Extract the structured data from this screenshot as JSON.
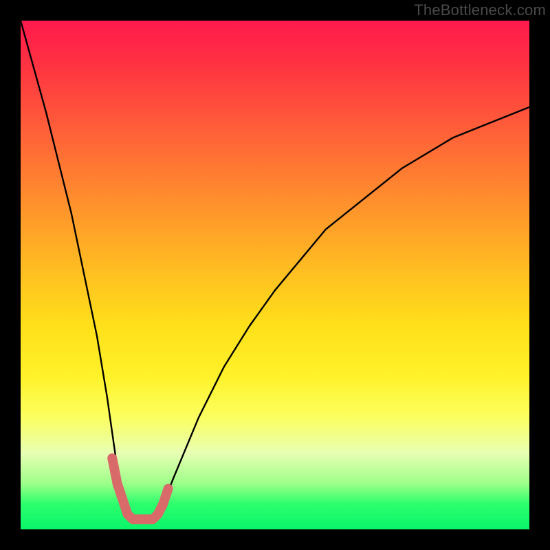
{
  "watermark": "TheBottleneck.com",
  "chart_data": {
    "type": "line",
    "title": "",
    "xlabel": "",
    "ylabel": "",
    "xlim": [
      0,
      100
    ],
    "ylim": [
      0,
      100
    ],
    "series": [
      {
        "name": "bottleneck-curve",
        "x": [
          0,
          5,
          10,
          15,
          17,
          19,
          20,
          21,
          22,
          23,
          24,
          25,
          26,
          27,
          28,
          30,
          35,
          40,
          45,
          50,
          55,
          60,
          65,
          70,
          75,
          80,
          85,
          90,
          95,
          100
        ],
        "y": [
          100,
          82,
          62,
          38,
          26,
          12,
          7,
          4,
          2,
          2,
          2,
          2,
          2,
          3,
          5,
          10,
          22,
          32,
          40,
          47,
          53,
          59,
          63,
          67,
          71,
          74,
          77,
          79,
          81,
          83
        ]
      },
      {
        "name": "highlight-zone",
        "x": [
          18,
          19,
          20,
          21,
          22,
          23,
          24,
          25,
          26,
          27,
          28,
          29
        ],
        "y": [
          14,
          9,
          6,
          3,
          2,
          2,
          2,
          2,
          2,
          3,
          5,
          8
        ]
      }
    ],
    "notes": "Axes unlabeled in source. x/y in percent of plot area (0=left/bottom, 100=right/top). Curve is a V-shaped bottleneck plot with minimum near x≈23%. Highlight-zone is the pink/red overdrawn segment around the minimum."
  }
}
